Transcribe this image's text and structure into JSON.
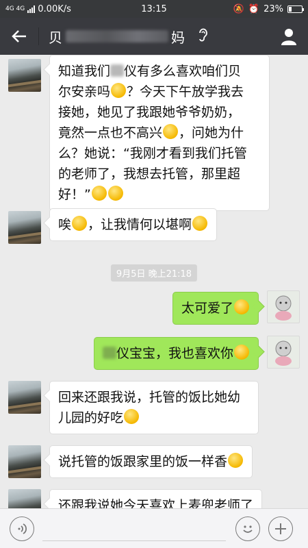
{
  "status_bar": {
    "signal": "4G 4G",
    "speed": "0.00K/s",
    "time": "13:15",
    "battery": "23%"
  },
  "header": {
    "back_icon": "arrow-left-icon",
    "title_start": "贝",
    "title_end": "妈",
    "ear_icon": "ear-icon",
    "profile_icon": "person-icon"
  },
  "messages": [
    {
      "side": "in",
      "lines": [
        "知道我们[smudge]仪有多么喜欢咱们贝",
        "尔安亲吗[emoji]？今天下午放学我去",
        "接她，她见了我跟她爷爷奶奶，",
        "竟然一点也不高兴[emoji]，问她为什",
        "么？她说：“我刚才看到我们托管",
        "的老师了，我想去托管，那里超",
        "好！”[emoji][emoji]"
      ]
    },
    {
      "side": "in",
      "lines": [
        "唉[emoji]，让我情何以堪啊[emoji]"
      ]
    },
    {
      "side": "out",
      "lines": [
        "太可爱了[emoji]"
      ]
    },
    {
      "side": "out",
      "lines": [
        "[smudge]仪宝宝，我也喜欢你[emoji]"
      ]
    },
    {
      "side": "in",
      "lines": [
        "回来还跟我说，托管的饭比她幼",
        "儿园的好吃[emoji]"
      ]
    },
    {
      "side": "in",
      "lines": [
        "说托管的饭跟家里的饭一样香[emoji]"
      ]
    },
    {
      "side": "in",
      "lines": [
        "还跟我说她今天喜欢上麦兜老师了"
      ]
    }
  ],
  "timestamp": "9月5日 晚上21:18",
  "input_bar": {
    "voice_icon": "voice-icon",
    "placeholder": "",
    "emoji_icon": "smiley-icon",
    "plus_icon": "plus-icon"
  },
  "colors": {
    "title_bar": "#393a3f",
    "status_bar": "#37393b",
    "chat_bg": "#ebebeb",
    "out_bubble": "#a0e75a",
    "in_bubble": "#ffffff"
  }
}
